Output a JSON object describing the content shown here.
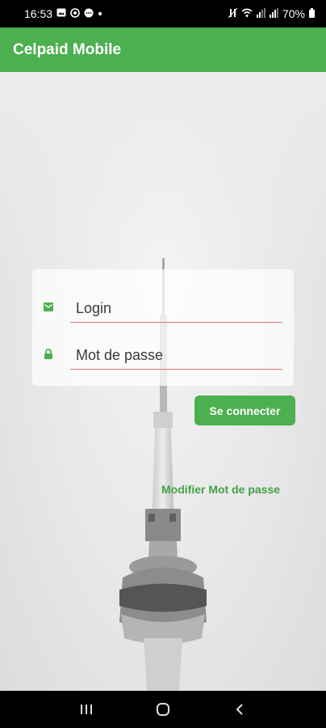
{
  "status_bar": {
    "time": "16:53",
    "battery": "70%",
    "icons_left": [
      "photo-icon",
      "whatsapp-icon",
      "chat-icon",
      "dot-icon"
    ],
    "icons_right": [
      "mute-icon",
      "wifi-icon",
      "signal-icon",
      "signal-icon",
      "battery-icon"
    ]
  },
  "app_bar": {
    "title": "Celpaid Mobile"
  },
  "form": {
    "login_placeholder": "Login",
    "password_placeholder": "Mot de passe",
    "login_icon": "mail-icon",
    "password_icon": "lock-icon"
  },
  "actions": {
    "connect_label": "Se connecter",
    "change_password_label": "Modifier Mot de passe"
  },
  "navigation": {
    "buttons": [
      "recent-apps",
      "home",
      "back"
    ]
  },
  "colors": {
    "primary": "#4caf50",
    "link": "#43a047",
    "underline": "#e57373"
  }
}
